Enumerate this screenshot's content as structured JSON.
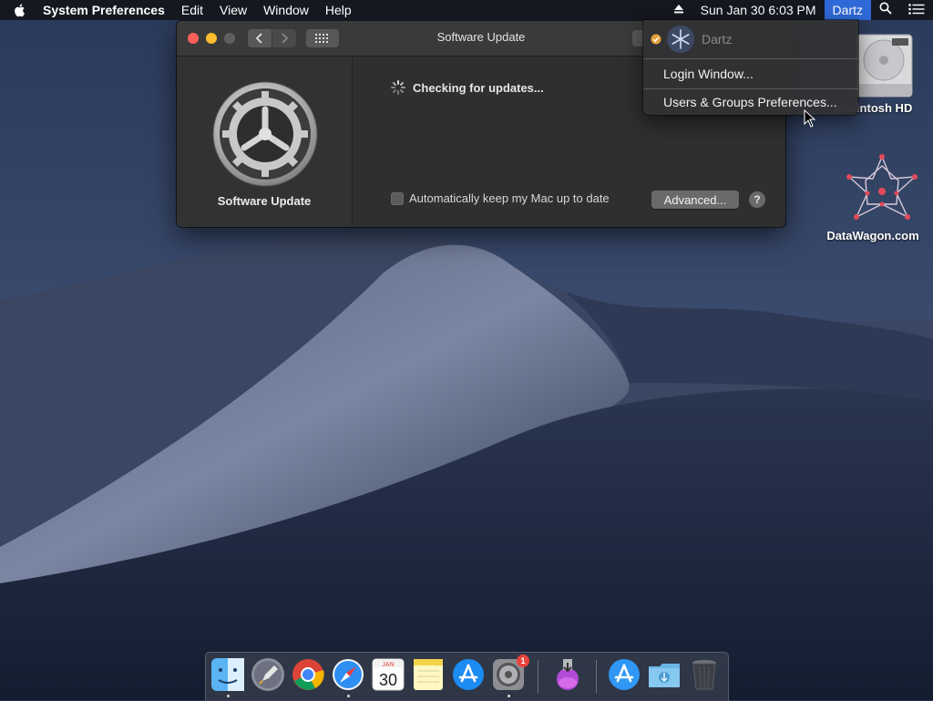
{
  "menubar": {
    "app_name": "System Preferences",
    "menus": [
      "Edit",
      "View",
      "Window",
      "Help"
    ],
    "clock": "Sun Jan 30  6:03 PM",
    "user": "Dartz"
  },
  "window": {
    "title": "Software Update",
    "pane_label": "Software Update",
    "status": "Checking for updates...",
    "auto_update_label": "Automatically keep my Mac up to date",
    "auto_update_checked": false,
    "advanced_label": "Advanced...",
    "help_label": "?"
  },
  "user_menu": {
    "current_user": "Dartz",
    "items": [
      "Login Window...",
      "Users & Groups Preferences..."
    ]
  },
  "desktop": {
    "icons": [
      "Macintosh HD",
      "DataWagon.com"
    ]
  },
  "dock": {
    "items": [
      {
        "name": "Finder",
        "icon": "finder-icon",
        "running": true
      },
      {
        "name": "Launchpad",
        "icon": "launchpad-icon",
        "running": false
      },
      {
        "name": "Google Chrome",
        "icon": "chrome-icon",
        "running": false
      },
      {
        "name": "Safari",
        "icon": "safari-icon",
        "running": true
      },
      {
        "name": "Calendar",
        "icon": "calendar-icon",
        "running": false,
        "day": "30",
        "month": "JAN"
      },
      {
        "name": "Notes",
        "icon": "notes-icon",
        "running": false
      },
      {
        "name": "App Store",
        "icon": "app-store-icon",
        "running": false
      },
      {
        "name": "System Preferences",
        "icon": "system-preferences-icon",
        "running": true,
        "badge": "1"
      },
      {
        "name": "Installer",
        "icon": "installer-icon",
        "running": false
      },
      {
        "name": "App Store Folder",
        "icon": "app-store-icon",
        "running": false
      },
      {
        "name": "Downloads",
        "icon": "downloads-folder-icon",
        "running": false
      },
      {
        "name": "Trash",
        "icon": "trash-icon",
        "running": false
      }
    ]
  },
  "colors": {
    "menu_highlight": "#2f6ad8",
    "close": "#fe5f57",
    "minimize": "#febc2e",
    "badge": "#e8433b"
  }
}
